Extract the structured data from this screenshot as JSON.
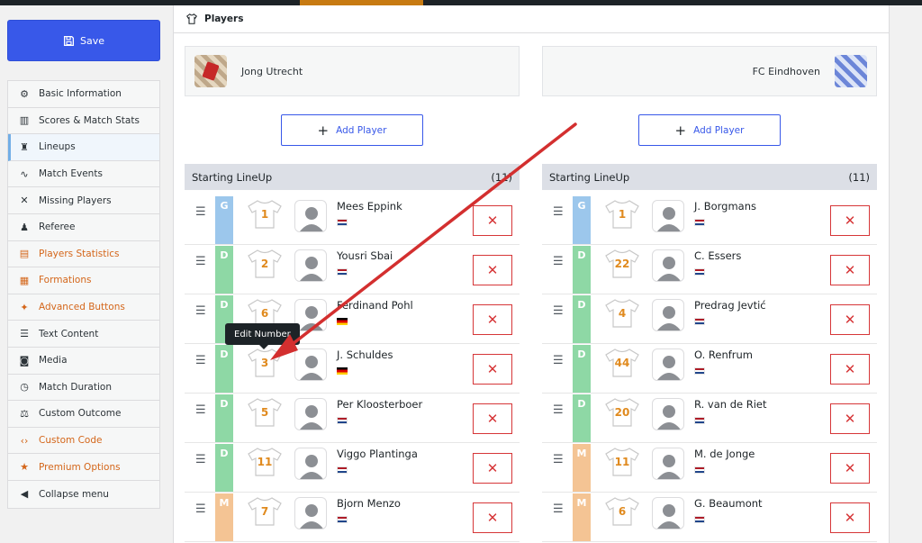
{
  "sidebar": {
    "save_label": "Save",
    "items": [
      {
        "label": "Basic Information",
        "icon": "gear-icon",
        "glyph": "⚙"
      },
      {
        "label": "Scores & Match Stats",
        "icon": "bar-chart-icon",
        "glyph": "▥"
      },
      {
        "label": "Lineups",
        "icon": "shirt-icon",
        "glyph": "♜"
      },
      {
        "label": "Match Events",
        "icon": "pulse-icon",
        "glyph": "∿"
      },
      {
        "label": "Missing Players",
        "icon": "x-icon",
        "glyph": "✕"
      },
      {
        "label": "Referee",
        "icon": "users-icon",
        "glyph": "♟"
      },
      {
        "label": "Players Statistics",
        "icon": "stats-icon",
        "glyph": "▤"
      },
      {
        "label": "Formations",
        "icon": "formation-icon",
        "glyph": "▦"
      },
      {
        "label": "Advanced Buttons",
        "icon": "magic-wand-icon",
        "glyph": "✦"
      },
      {
        "label": "Text Content",
        "icon": "text-icon",
        "glyph": "☰"
      },
      {
        "label": "Media",
        "icon": "camera-icon",
        "glyph": "◙"
      },
      {
        "label": "Match Duration",
        "icon": "stopwatch-icon",
        "glyph": "◷"
      },
      {
        "label": "Custom Outcome",
        "icon": "scales-icon",
        "glyph": "⚖"
      },
      {
        "label": "Custom Code",
        "icon": "code-icon",
        "glyph": "‹›"
      },
      {
        "label": "Premium Options",
        "icon": "star-icon",
        "glyph": "★"
      },
      {
        "label": "Collapse menu",
        "icon": "collapse-icon",
        "glyph": "◀"
      }
    ],
    "active_index": 2,
    "orange_indices": [
      6,
      7,
      8,
      13,
      14
    ]
  },
  "panel": {
    "title": "Players",
    "tooltip": "Edit Number"
  },
  "teams": [
    {
      "name": "Jong Utrecht",
      "add_label": "Add Player",
      "lineup_title": "Starting LineUp",
      "count": "(11)",
      "players": [
        {
          "pos": "G",
          "number": "1",
          "name": "Mees Eppink",
          "flag": "nl"
        },
        {
          "pos": "D",
          "number": "2",
          "name": "Yousri Sbai",
          "flag": "nl"
        },
        {
          "pos": "D",
          "number": "6",
          "name": "Ferdinand Pohl",
          "flag": "de"
        },
        {
          "pos": "D",
          "number": "3",
          "name": "J. Schuldes",
          "flag": "de"
        },
        {
          "pos": "D",
          "number": "5",
          "name": "Per Kloosterboer",
          "flag": "nl"
        },
        {
          "pos": "D",
          "number": "11",
          "name": "Viggo Plantinga",
          "flag": "nl"
        },
        {
          "pos": "M",
          "number": "7",
          "name": "Bjorn Menzo",
          "flag": "nl"
        }
      ]
    },
    {
      "name": "FC Eindhoven",
      "add_label": "Add Player",
      "lineup_title": "Starting LineUp",
      "count": "(11)",
      "players": [
        {
          "pos": "G",
          "number": "1",
          "name": "J. Borgmans",
          "flag": "nl"
        },
        {
          "pos": "D",
          "number": "22",
          "name": "C. Essers",
          "flag": "nl"
        },
        {
          "pos": "D",
          "number": "4",
          "name": "Predrag Jevtić",
          "flag": "nl"
        },
        {
          "pos": "D",
          "number": "44",
          "name": "O. Renfrum",
          "flag": "nl"
        },
        {
          "pos": "D",
          "number": "20",
          "name": "R. van de Riet",
          "flag": "nl"
        },
        {
          "pos": "M",
          "number": "11",
          "name": "M. de Jonge",
          "flag": "nl"
        },
        {
          "pos": "M",
          "number": "6",
          "name": "G. Beaumont",
          "flag": "nl"
        }
      ]
    }
  ],
  "colors": {
    "accent": "#3858e9",
    "delete": "#d63638",
    "number": "#e08a1e",
    "annotation_arrow": "#d32f2f"
  }
}
